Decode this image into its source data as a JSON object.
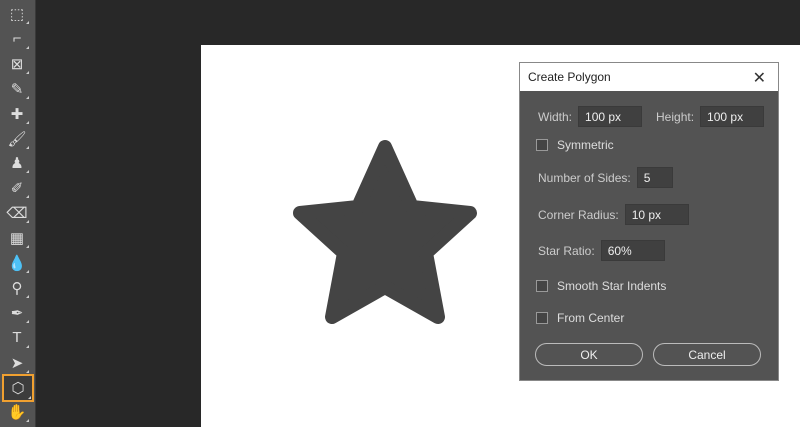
{
  "toolbar": {
    "tools": [
      {
        "name": "artboard",
        "glyph": "⬚"
      },
      {
        "name": "crop",
        "glyph": "⌐"
      },
      {
        "name": "frame",
        "glyph": "⊠"
      },
      {
        "name": "eyedropper",
        "glyph": "✎"
      },
      {
        "name": "healing",
        "glyph": "✚"
      },
      {
        "name": "brush",
        "glyph": "🖌"
      },
      {
        "name": "stamp",
        "glyph": "♟"
      },
      {
        "name": "history-brush",
        "glyph": "✐"
      },
      {
        "name": "eraser",
        "glyph": "⌫"
      },
      {
        "name": "gradient",
        "glyph": "▦"
      },
      {
        "name": "blur",
        "glyph": "💧"
      },
      {
        "name": "dodge",
        "glyph": "⚲"
      },
      {
        "name": "pen",
        "glyph": "✒"
      },
      {
        "name": "type",
        "glyph": "T"
      },
      {
        "name": "path-select",
        "glyph": "➤"
      },
      {
        "name": "polygon",
        "glyph": "⬡"
      },
      {
        "name": "hand",
        "glyph": "✋"
      }
    ],
    "selected": "polygon"
  },
  "dialog": {
    "title": "Create Polygon",
    "close": "✕",
    "width_label": "Width:",
    "width_value": "100 px",
    "height_label": "Height:",
    "height_value": "100 px",
    "symmetric": "Symmetric",
    "sides_label": "Number of Sides:",
    "sides_value": "5",
    "radius_label": "Corner Radius:",
    "radius_value": "10 px",
    "ratio_label": "Star Ratio:",
    "ratio_value": "60%",
    "smooth": "Smooth Star Indents",
    "center": "From Center",
    "ok": "OK",
    "cancel": "Cancel"
  },
  "colors": {
    "star": "#444444",
    "accent": "#f0a030"
  }
}
